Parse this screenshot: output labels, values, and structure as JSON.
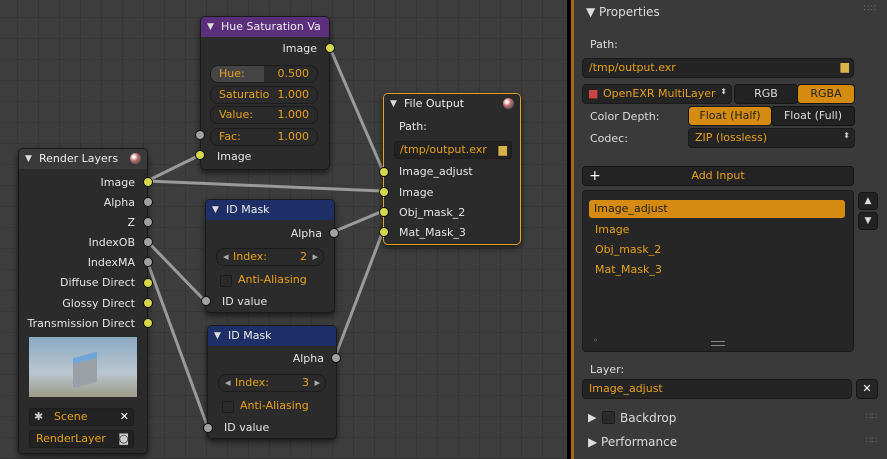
{
  "nodes": {
    "hue": {
      "title": "Hue Saturation Va",
      "out_image": "Image",
      "fields": [
        {
          "k": "Hue:",
          "v": "0.500"
        },
        {
          "k": "Saturatio",
          "v": "1.000"
        },
        {
          "k": "Value:",
          "v": "1.000"
        },
        {
          "k": "Fac:",
          "v": "1.000"
        }
      ],
      "in_image": "Image"
    },
    "render": {
      "title": "Render Layers",
      "outputs": [
        "Image",
        "Alpha",
        "Z",
        "IndexOB",
        "IndexMA",
        "Diffuse Direct",
        "Glossy Direct",
        "Transmission Direct"
      ],
      "scene": "Scene",
      "layer": "RenderLayer"
    },
    "idmask1": {
      "title": "ID Mask",
      "out": "Alpha",
      "index_label": "Index:",
      "index_value": "2",
      "aa": "Anti-Aliasing",
      "in": "ID value"
    },
    "idmask2": {
      "title": "ID Mask",
      "out": "Alpha",
      "index_label": "Index:",
      "index_value": "3",
      "aa": "Anti-Aliasing",
      "in": "ID value"
    },
    "fileout": {
      "title": "File Output",
      "path_label": "Path:",
      "path": "/tmp/output.exr",
      "inputs": [
        "Image_adjust",
        "Image",
        "Obj_mask_2",
        "Mat_Mask_3"
      ]
    }
  },
  "panel": {
    "title": "Properties",
    "path_label": "Path:",
    "path": "/tmp/output.exr",
    "format": "OpenEXR MultiLayer",
    "rgb": "RGB",
    "rgba": "RGBA",
    "depth_label": "Color Depth:",
    "depth_half": "Float (Half)",
    "depth_full": "Float (Full)",
    "codec_label": "Codec:",
    "codec": "ZIP (lossless)",
    "add_input": "Add Input",
    "inputs": [
      "Image_adjust",
      "Image",
      "Obj_mask_2",
      "Mat_Mask_3"
    ],
    "layer_label": "Layer:",
    "layer": "Image_adjust",
    "backdrop": "Backdrop",
    "performance": "Performance"
  },
  "colors": {
    "accent": "#e8a118",
    "hue_header": "#5c2f7d",
    "idmask_header": "#1d2f66"
  }
}
